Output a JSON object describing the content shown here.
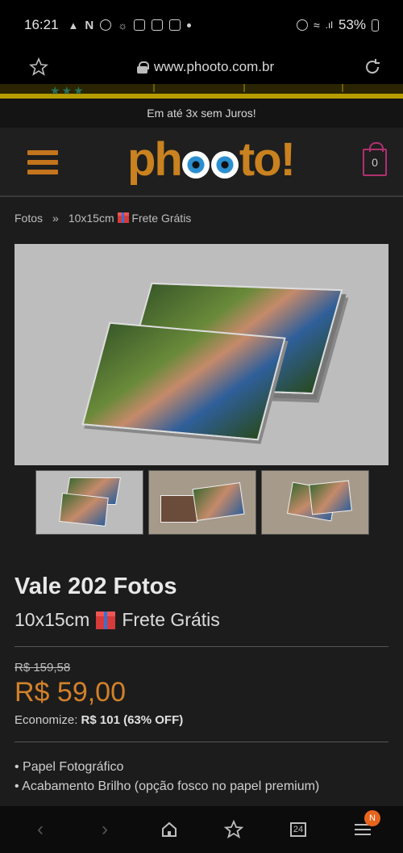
{
  "status_bar": {
    "time": "16:21",
    "battery": "53%",
    "icons": [
      "alarm-icon",
      "n-icon",
      "dfr-icon",
      "cloud-icon",
      "instagram-icon",
      "instagram-icon",
      "mail-icon",
      "dot-icon",
      "clock-icon",
      "wifi-icon",
      "signal-icon",
      "battery-icon"
    ]
  },
  "browser": {
    "url": "www.phooto.com.br"
  },
  "promo": "Em até 3x sem Juros!",
  "header": {
    "logo": "phooto!",
    "cart_count": "0"
  },
  "breadcrumb": {
    "root": "Fotos",
    "separator": "»",
    "current": "10x15cm",
    "current_suffix": "Frete Grátis"
  },
  "product": {
    "title": "Vale 202 Fotos",
    "subtitle_size": "10x15cm",
    "subtitle_shipping": "Frete Grátis",
    "old_price": "R$ 159,58",
    "price": "R$ 59,00",
    "savings_label": "Economize:",
    "savings_value": "R$ 101 (63% OFF)",
    "features": [
      "• Papel Fotográfico",
      "• Acabamento Brilho (opção fosco no papel premium)"
    ]
  },
  "thumbnails": [
    "thumb-1",
    "thumb-2",
    "thumb-3"
  ],
  "nav_bar": {
    "tabs_count": "24",
    "menu_badge": "N"
  },
  "colors": {
    "accent_orange": "#d2812a",
    "cart_magenta": "#b0306f",
    "stripe_yellow": "#b89d00"
  }
}
